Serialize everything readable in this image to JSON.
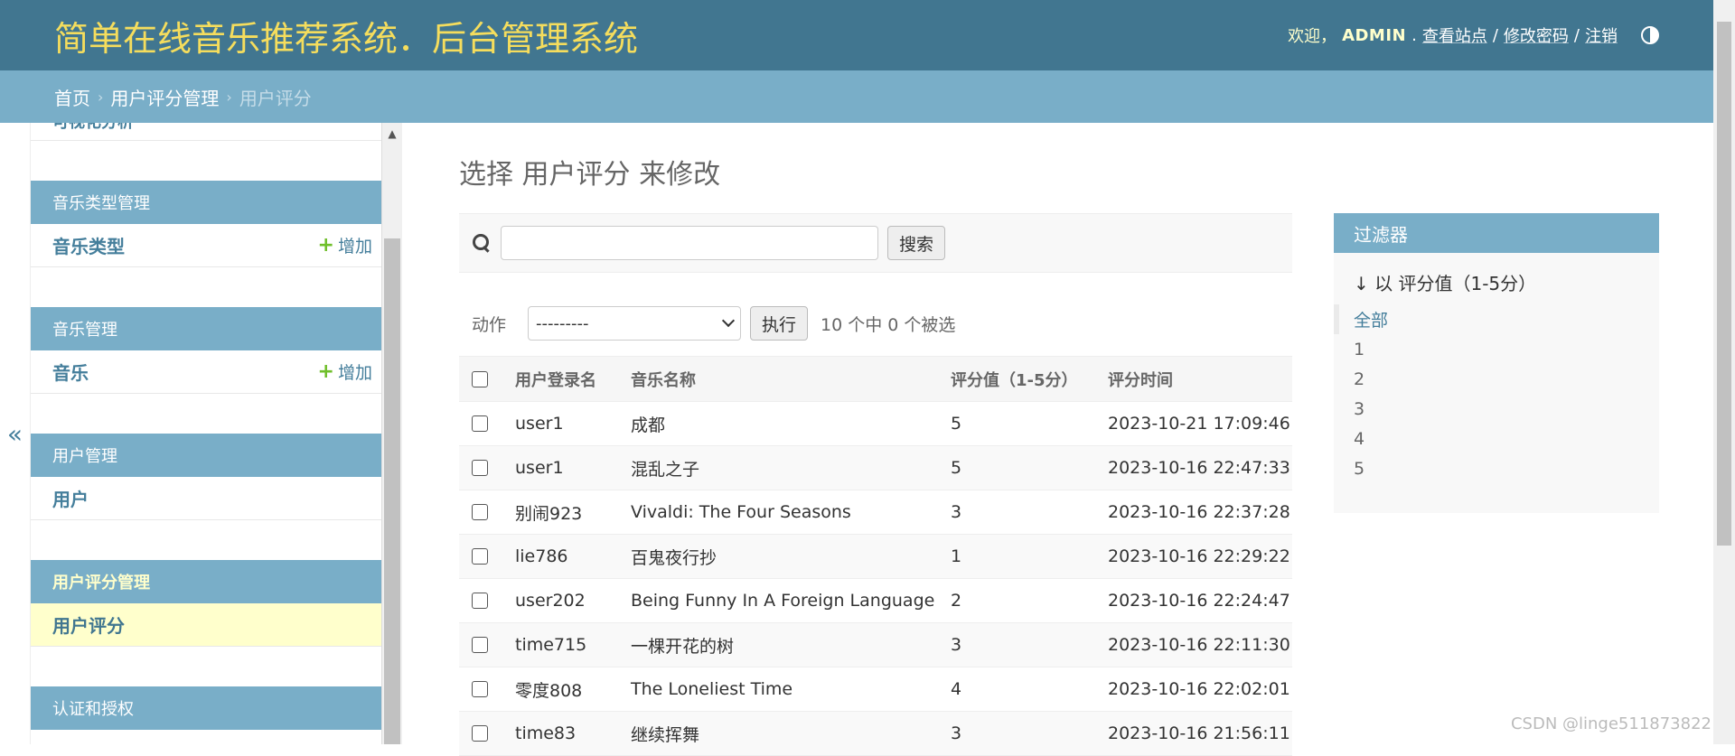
{
  "header": {
    "site_title": "简单在线音乐推荐系统．后台管理系统",
    "welcome": "欢迎，",
    "username": "ADMIN",
    "view_site": "查看站点",
    "change_password": "修改密码",
    "logout": "注销",
    "sep": "/"
  },
  "breadcrumbs": {
    "home": "首页",
    "app": "用户评分管理",
    "current": "用户评分",
    "arrow": "›"
  },
  "nav_toggle": "«",
  "sidebar": {
    "partial_item": "可视化分析",
    "modules": [
      {
        "caption": "音乐类型管理",
        "items": [
          {
            "label": "音乐类型",
            "add": "增加"
          }
        ]
      },
      {
        "caption": "音乐管理",
        "items": [
          {
            "label": "音乐",
            "add": "增加"
          }
        ]
      },
      {
        "caption": "用户管理",
        "items": [
          {
            "label": "用户"
          }
        ]
      },
      {
        "caption": "用户评分管理",
        "items": [
          {
            "label": "用户评分"
          }
        ]
      },
      {
        "caption": "认证和授权"
      }
    ]
  },
  "content": {
    "title": "选择 用户评分 来修改",
    "search_button": "搜索",
    "action_label": "动作",
    "action_selected": "---------",
    "go_button": "执行",
    "counter": "10 个中 0 个被选"
  },
  "table": {
    "headers": [
      "用户登录名",
      "音乐名称",
      "评分值（1-5分）",
      "评分时间"
    ],
    "rows": [
      [
        "user1",
        "成都",
        "5",
        "2023-10-21 17:09:46"
      ],
      [
        "user1",
        "混乱之子",
        "5",
        "2023-10-16 22:47:33"
      ],
      [
        "别闹923",
        "Vivaldi: The Four Seasons",
        "3",
        "2023-10-16 22:37:28"
      ],
      [
        "lie786",
        "百鬼夜行抄",
        "1",
        "2023-10-16 22:29:22"
      ],
      [
        "user202",
        "Being Funny In A Foreign Language",
        "2",
        "2023-10-16 22:24:47"
      ],
      [
        "time715",
        "一棵开花的树",
        "3",
        "2023-10-16 22:11:30"
      ],
      [
        "零度808",
        "The Loneliest Time",
        "4",
        "2023-10-16 22:02:01"
      ],
      [
        "time83",
        "继续挥舞",
        "3",
        "2023-10-16 21:56:11"
      ]
    ]
  },
  "filter": {
    "title": "过滤器",
    "heading": "↓ 以 评分值（1-5分）",
    "options": [
      "全部",
      "1",
      "2",
      "3",
      "4",
      "5"
    ]
  },
  "watermark": "CSDN @linge511873822"
}
